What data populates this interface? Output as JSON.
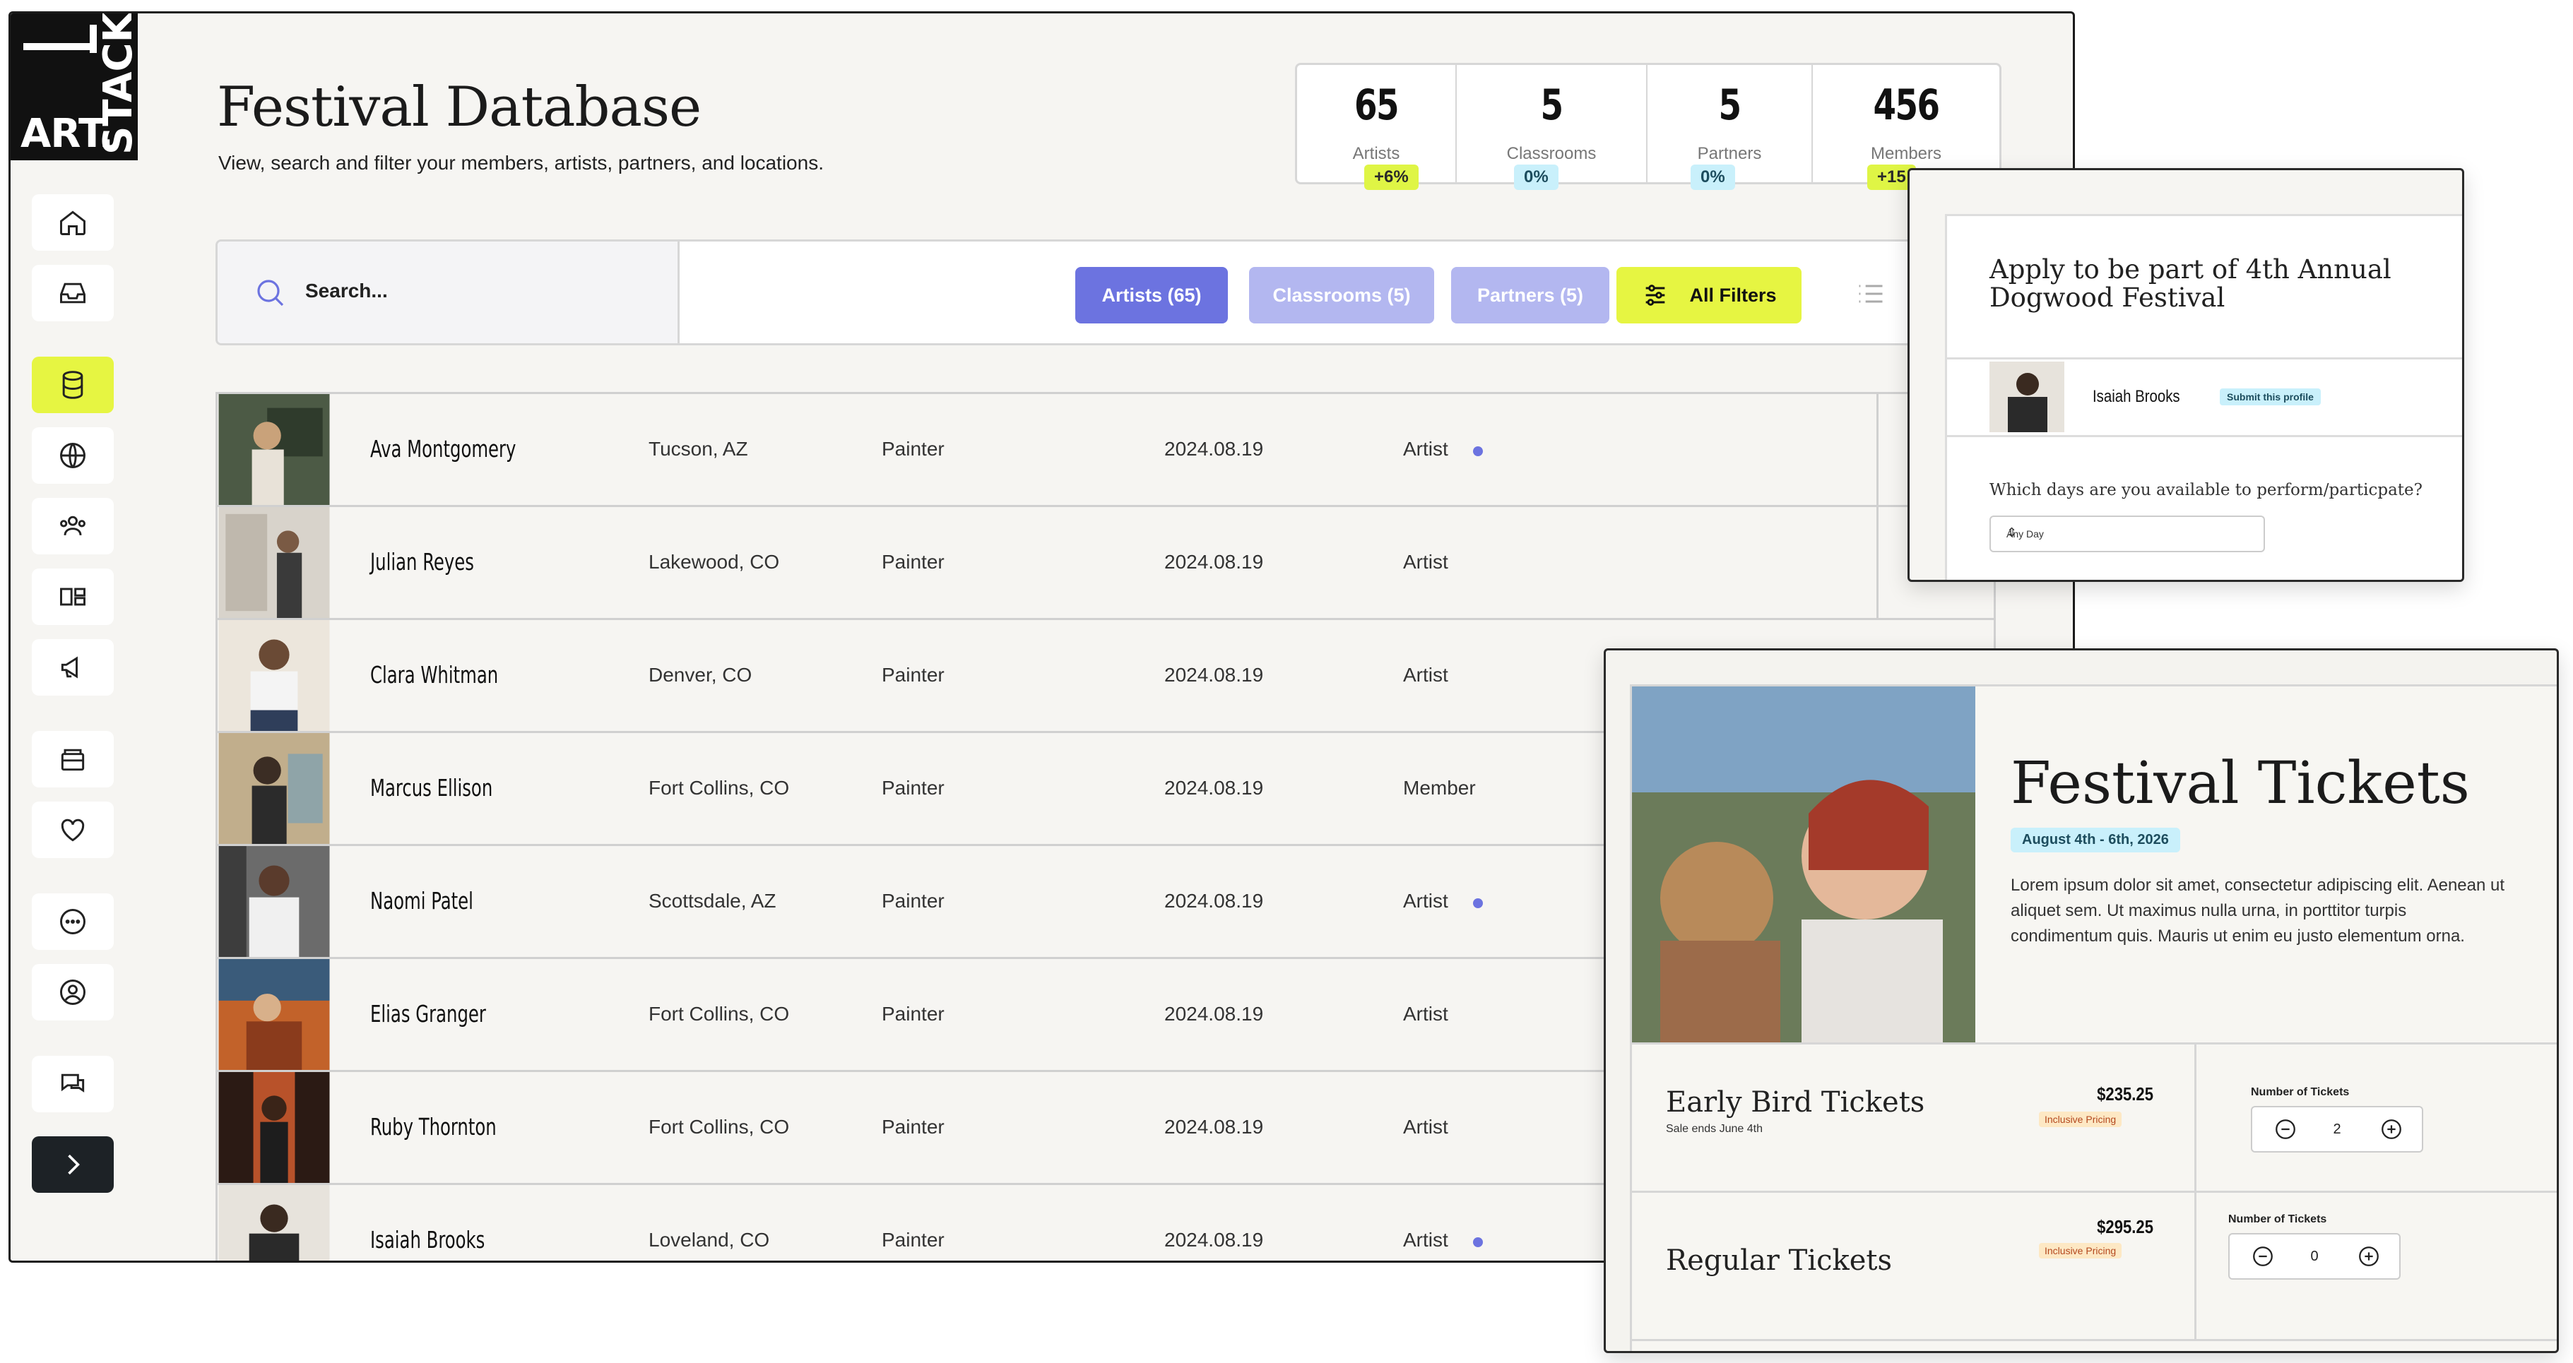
{
  "brand": {
    "logo_text_1": "ART.",
    "logo_text_2": "STACK"
  },
  "colors": {
    "accent_lime": "#e6f542",
    "accent_indigo": "#6c73e0",
    "soft_indigo": "#b3b7f0",
    "info_cyan": "#c9f0fb"
  },
  "sidebar": {
    "items": [
      {
        "icon": "home-icon"
      },
      {
        "icon": "inbox-icon"
      },
      {
        "icon": "database-icon",
        "active": true
      },
      {
        "icon": "globe-icon"
      },
      {
        "icon": "users-icon"
      },
      {
        "icon": "layout-icon"
      },
      {
        "icon": "megaphone-icon"
      },
      {
        "icon": "archive-icon"
      },
      {
        "icon": "heart-icon"
      },
      {
        "icon": "more-icon"
      },
      {
        "icon": "user-icon"
      },
      {
        "icon": "chat-icon"
      },
      {
        "icon": "expand-icon"
      }
    ]
  },
  "header": {
    "title": "Festival Database",
    "subtitle": "View, search and filter your members, artists, partners, and locations."
  },
  "stats": [
    {
      "value": "65",
      "label": "Artists",
      "change": "+6%"
    },
    {
      "value": "5",
      "label": "Classrooms",
      "change": "0%"
    },
    {
      "value": "5",
      "label": "Partners",
      "change": "0%"
    },
    {
      "value": "456",
      "label": "Members",
      "change": "+15"
    }
  ],
  "search": {
    "placeholder": "Search..."
  },
  "filters": {
    "artists": "Artists (65)",
    "classrooms": "Classrooms (5)",
    "partners": "Partners (5)",
    "all": "All Filters"
  },
  "table": {
    "rows": [
      {
        "name": "Ava Montgomery",
        "location": "Tucson, AZ",
        "role": "Painter",
        "date": "2024.08.19",
        "type": "Artist",
        "dot": true
      },
      {
        "name": "Julian Reyes",
        "location": "Lakewood, CO",
        "role": "Painter",
        "date": "2024.08.19",
        "type": "Artist",
        "dot": false
      },
      {
        "name": "Clara Whitman",
        "location": "Denver, CO",
        "role": "Painter",
        "date": "2024.08.19",
        "type": "Artist",
        "dot": false
      },
      {
        "name": "Marcus Ellison",
        "location": "Fort Collins, CO",
        "role": "Painter",
        "date": "2024.08.19",
        "type": "Member",
        "dot": false
      },
      {
        "name": "Naomi Patel",
        "location": "Scottsdale, AZ",
        "role": "Painter",
        "date": "2024.08.19",
        "type": "Artist",
        "dot": true
      },
      {
        "name": "Elias Granger",
        "location": "Fort Collins, CO",
        "role": "Painter",
        "date": "2024.08.19",
        "type": "Artist",
        "dot": false
      },
      {
        "name": "Ruby Thornton",
        "location": "Fort Collins, CO",
        "role": "Painter",
        "date": "2024.08.19",
        "type": "Artist",
        "dot": false
      },
      {
        "name": "Isaiah Brooks",
        "location": "Loveland, CO",
        "role": "Painter",
        "date": "2024.08.19",
        "type": "Artist",
        "dot": true
      }
    ]
  },
  "application": {
    "title": "Apply to be part of 4th Annual Dogwood Festival",
    "profile_name": "Isaiah Brooks",
    "submit_label": "Submit this profile",
    "question": "Which days are you available to perform/particpate?",
    "select_value": "Any Day"
  },
  "tickets": {
    "title": "Festival Tickets",
    "date_badge": "August 4th - 6th, 2026",
    "description": "Lorem ipsum dolor sit amet, consectetur adipiscing elit. Aenean ut aliquet sem. Ut maximus nulla urna, in porttitor turpis condimentum quis. Mauris ut enim eu justo elementum orna.",
    "items": [
      {
        "name": "Early Bird Tickets",
        "note": "Sale ends June 4th",
        "price": "$235.25",
        "badge": "Inclusive Pricing",
        "qty_label": "Number of Tickets",
        "qty": "2"
      },
      {
        "name": "Regular Tickets",
        "note": "",
        "price": "$295.25",
        "badge": "Inclusive Pricing",
        "qty_label": "Number of Tickets",
        "qty": "0"
      }
    ]
  }
}
